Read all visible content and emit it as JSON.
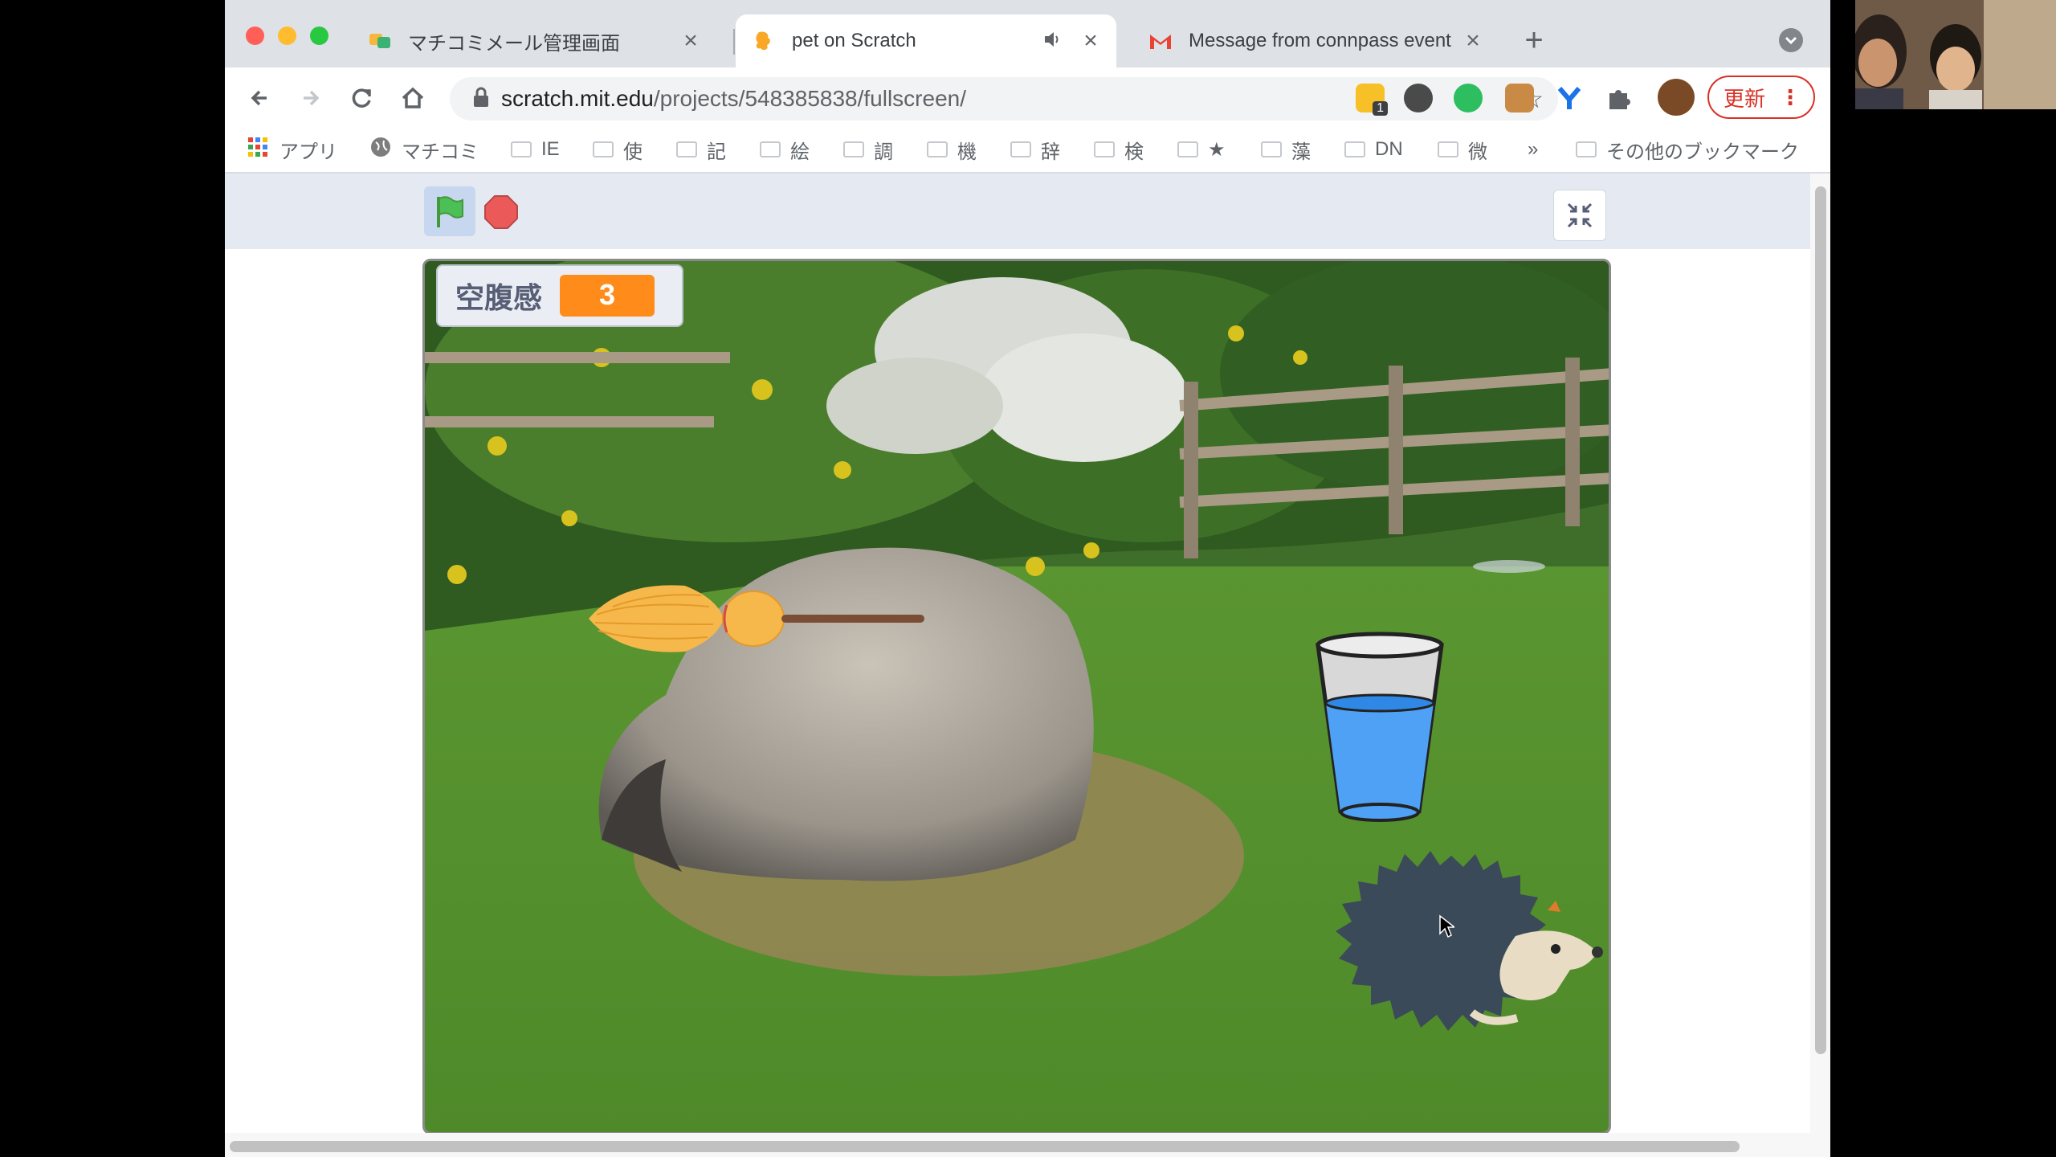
{
  "browser": {
    "tabs": [
      {
        "title": "マチコミメール管理画面",
        "favicon": "machicomi-icon",
        "active": false
      },
      {
        "title": "pet on Scratch",
        "favicon": "scratch-icon",
        "active": true,
        "audio": true
      },
      {
        "title": "Message from connpass event",
        "favicon": "gmail-icon",
        "active": false
      }
    ],
    "new_tab": "+",
    "close_glyph": "×",
    "url_host": "scratch.mit.edu",
    "url_path": "/projects/548385838/fullscreen/",
    "update_label": "更新",
    "update_menu": "⋮",
    "extension_badge": "1"
  },
  "bookmarks": [
    {
      "label": "アプリ",
      "icon": "apps-grid-icon"
    },
    {
      "label": "マチコミ",
      "icon": "globe-icon"
    },
    {
      "label": "IE",
      "icon": "folder-icon"
    },
    {
      "label": "使",
      "icon": "folder-icon"
    },
    {
      "label": "記",
      "icon": "folder-icon"
    },
    {
      "label": "絵",
      "icon": "folder-icon"
    },
    {
      "label": "調",
      "icon": "folder-icon"
    },
    {
      "label": "機",
      "icon": "folder-icon"
    },
    {
      "label": "辞",
      "icon": "folder-icon"
    },
    {
      "label": "検",
      "icon": "folder-icon"
    },
    {
      "label": "★",
      "icon": "folder-icon"
    },
    {
      "label": "藻",
      "icon": "folder-icon"
    },
    {
      "label": "DN",
      "icon": "folder-icon"
    },
    {
      "label": "微",
      "icon": "folder-icon"
    },
    {
      "label": "»",
      "icon": "chevron-right-icon"
    },
    {
      "label": "その他のブックマーク",
      "icon": "folder-icon"
    }
  ],
  "scratch": {
    "variable_label": "空腹感",
    "variable_value": "3",
    "colors": {
      "flag": "#4cbf56",
      "stop": "#ec5959",
      "monitor": "#ff8c1a"
    },
    "sprites": [
      "broom",
      "glass-of-water",
      "hedgehog"
    ],
    "backdrop": "garden-with-rock"
  }
}
